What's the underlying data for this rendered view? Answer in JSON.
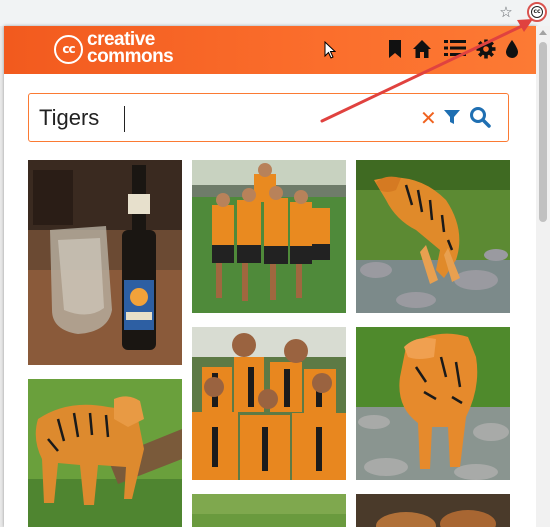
{
  "browser": {
    "star_icon": "star-icon",
    "extension_icon": "creative-commons-extension-icon",
    "extension_glyph": "cc"
  },
  "header": {
    "logo_mark": "cc",
    "logo_line1": "creative",
    "logo_line2": "commons",
    "icons": [
      "bookmark-icon",
      "home-icon",
      "list-icon",
      "gear-icon",
      "drop-icon"
    ]
  },
  "search": {
    "value": "Tigers",
    "clear_glyph": "✕",
    "icons": [
      "clear-icon",
      "filter-icon",
      "search-icon"
    ]
  },
  "results": [
    {
      "name": "photo-tiger-beer"
    },
    {
      "name": "photo-rugby-team-celebration"
    },
    {
      "name": "photo-tiger-walking-water"
    },
    {
      "name": "photo-rugby-team-huddle"
    },
    {
      "name": "photo-tiger-stepping-stream"
    },
    {
      "name": "photo-tiger-standing-log"
    },
    {
      "name": "photo-grass-field"
    },
    {
      "name": "photo-tiger-cubs"
    }
  ],
  "colors": {
    "accent": "#fb6e2c",
    "annotation_arrow": "#e0423f"
  }
}
